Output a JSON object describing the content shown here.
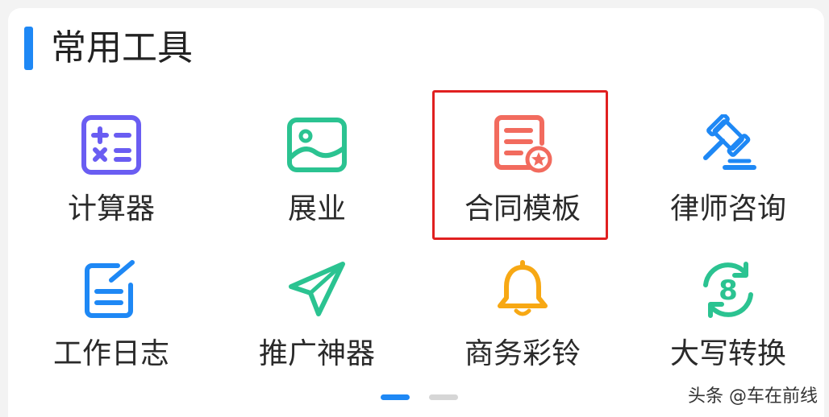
{
  "section": {
    "title": "常用工具",
    "accent_color": "#1e88f5"
  },
  "tools": [
    {
      "label": "计算器",
      "icon": "calculator-icon",
      "color": "#6a5df2"
    },
    {
      "label": "展业",
      "icon": "image-icon",
      "color": "#2bc391"
    },
    {
      "label": "合同模板",
      "icon": "contract-document-icon",
      "color": "#f26b5e",
      "highlighted": true
    },
    {
      "label": "律师咨询",
      "icon": "gavel-icon",
      "color": "#1e88f5"
    },
    {
      "label": "工作日志",
      "icon": "edit-note-icon",
      "color": "#1e88f5"
    },
    {
      "label": "推广神器",
      "icon": "paper-plane-icon",
      "color": "#2bc391"
    },
    {
      "label": "商务彩铃",
      "icon": "bell-icon",
      "color": "#f7a814"
    },
    {
      "label": "大写转换",
      "icon": "convert-cycle-icon",
      "color": "#2bc391"
    }
  ],
  "pagination": {
    "active_color": "#1e88f5",
    "inactive_color": "#d6d6d6"
  },
  "watermark": "头条 @车在前线",
  "highlight_color": "#e02020"
}
